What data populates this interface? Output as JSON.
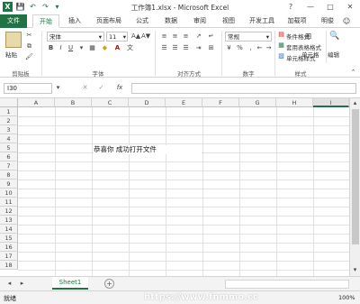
{
  "titlebar": {
    "title": "工作簿1.xlsx - Microsoft Excel",
    "help": "?",
    "restore": "□",
    "minimize": "—",
    "maximize": "□",
    "close": "✕"
  },
  "qat": {
    "save": "💾",
    "undo": "↶",
    "redo": "↷",
    "customize": "▾"
  },
  "tabs": [
    "文件",
    "开始",
    "插入",
    "页面布局",
    "公式",
    "数据",
    "审阅",
    "视图",
    "开发工具",
    "加载项"
  ],
  "user": "明俊",
  "ribbon": {
    "paste": "粘贴",
    "font_name": "宋体",
    "font_size": "11",
    "bold": "B",
    "italic": "I",
    "underline": "U",
    "grow_font": "A▲",
    "shrink_font": "A▼",
    "number_format": "常规",
    "percent": "%",
    "comma": ",",
    "conditional_format": "条件格式",
    "table_format": "套用表格格式",
    "cell_styles": "单元格样式",
    "cells": "单元格",
    "editing": "编辑",
    "groups": {
      "clipboard": "剪贴板",
      "font": "字体",
      "alignment": "对齐方式",
      "number": "数字",
      "styles": "样式"
    }
  },
  "formula_bar": {
    "name_box": "I30",
    "fx": "fx",
    "value": ""
  },
  "columns": [
    "A",
    "B",
    "C",
    "D",
    "E",
    "F",
    "G",
    "H",
    "I"
  ],
  "rows": [
    "1",
    "2",
    "3",
    "4",
    "5",
    "6",
    "7",
    "8",
    "9",
    "10",
    "11",
    "12",
    "13",
    "14",
    "15",
    "16",
    "17",
    "18"
  ],
  "cells": {
    "C5": "恭喜你  成功打开文件"
  },
  "sheet_tab": "Sheet1",
  "add_sheet": "+",
  "status": {
    "ready": "就绪",
    "zoom": "100%"
  },
  "watermark": "https://www.fnmmo.cc",
  "colors": {
    "accent": "#217346",
    "file_tab": "#217346"
  }
}
